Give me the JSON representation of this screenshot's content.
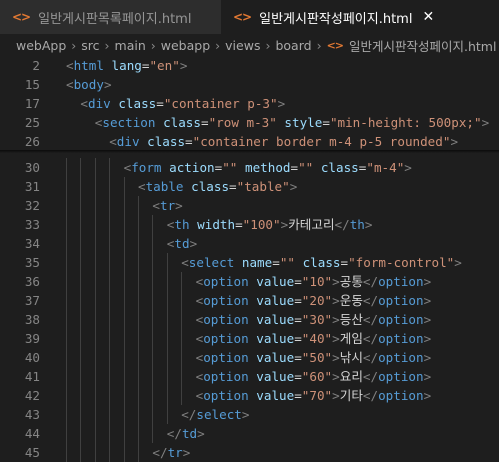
{
  "tabs": [
    {
      "icon": "<>",
      "label": "일반게시판목록페이지.html",
      "active": false
    },
    {
      "icon": "<>",
      "label": "일반게시판작성페이지.html",
      "active": true,
      "close": "✕"
    }
  ],
  "breadcrumb": {
    "items": [
      "webApp",
      "src",
      "main",
      "webapp",
      "views",
      "board"
    ],
    "file_icon": "<>",
    "file": "일반게시판작성페이지.html"
  },
  "colors": {
    "tag": "#569cd6",
    "attr": "#9cdcfe",
    "string": "#ce9178",
    "text": "#d4d4d4",
    "line_number": "#858585",
    "file_icon": "#e37933"
  },
  "lines": [
    {
      "n": "2",
      "indent": 0,
      "tokens": [
        [
          "br",
          "<"
        ],
        [
          "tg",
          "html"
        ],
        [
          "tx",
          " "
        ],
        [
          "at",
          "lang"
        ],
        [
          "tx",
          "="
        ],
        [
          "st",
          "\"en\""
        ],
        [
          "br",
          ">"
        ]
      ]
    },
    {
      "n": "15",
      "indent": 0,
      "tokens": [
        [
          "br",
          "<"
        ],
        [
          "tg",
          "body"
        ],
        [
          "br",
          ">"
        ]
      ]
    },
    {
      "n": "17",
      "indent": 1,
      "tokens": [
        [
          "br",
          "<"
        ],
        [
          "tg",
          "div"
        ],
        [
          "tx",
          " "
        ],
        [
          "at",
          "class"
        ],
        [
          "tx",
          "="
        ],
        [
          "st",
          "\"container p-3\""
        ],
        [
          "br",
          ">"
        ]
      ]
    },
    {
      "n": "25",
      "indent": 2,
      "tokens": [
        [
          "br",
          "<"
        ],
        [
          "tg",
          "section"
        ],
        [
          "tx",
          " "
        ],
        [
          "at",
          "class"
        ],
        [
          "tx",
          "="
        ],
        [
          "st",
          "\"row m-3\""
        ],
        [
          "tx",
          " "
        ],
        [
          "at",
          "style"
        ],
        [
          "tx",
          "="
        ],
        [
          "st",
          "\"min-height: 500px;\""
        ],
        [
          "br",
          ">"
        ]
      ]
    },
    {
      "n": "26",
      "indent": 3,
      "tokens": [
        [
          "br",
          "<"
        ],
        [
          "tg",
          "div"
        ],
        [
          "tx",
          " "
        ],
        [
          "at",
          "class"
        ],
        [
          "tx",
          "="
        ],
        [
          "st",
          "\"container border m-4 p-5 rounded\""
        ],
        [
          "br",
          ">"
        ]
      ]
    },
    {
      "n": "30",
      "indent": 4,
      "tokens": [
        [
          "br",
          "<"
        ],
        [
          "tg",
          "form"
        ],
        [
          "tx",
          " "
        ],
        [
          "at",
          "action"
        ],
        [
          "tx",
          "="
        ],
        [
          "st",
          "\"\""
        ],
        [
          "tx",
          " "
        ],
        [
          "at",
          "method"
        ],
        [
          "tx",
          "="
        ],
        [
          "st",
          "\"\""
        ],
        [
          "tx",
          " "
        ],
        [
          "at",
          "class"
        ],
        [
          "tx",
          "="
        ],
        [
          "st",
          "\"m-4\""
        ],
        [
          "br",
          ">"
        ]
      ]
    },
    {
      "n": "31",
      "indent": 5,
      "tokens": [
        [
          "br",
          "<"
        ],
        [
          "tg",
          "table"
        ],
        [
          "tx",
          " "
        ],
        [
          "at",
          "class"
        ],
        [
          "tx",
          "="
        ],
        [
          "st",
          "\"table\""
        ],
        [
          "br",
          ">"
        ]
      ]
    },
    {
      "n": "32",
      "indent": 6,
      "tokens": [
        [
          "br",
          "<"
        ],
        [
          "tg",
          "tr"
        ],
        [
          "br",
          ">"
        ]
      ]
    },
    {
      "n": "33",
      "indent": 7,
      "tokens": [
        [
          "br",
          "<"
        ],
        [
          "tg",
          "th"
        ],
        [
          "tx",
          " "
        ],
        [
          "at",
          "width"
        ],
        [
          "tx",
          "="
        ],
        [
          "st",
          "\"100\""
        ],
        [
          "br",
          ">"
        ],
        [
          "tx",
          "카테고리"
        ],
        [
          "br",
          "</"
        ],
        [
          "tg",
          "th"
        ],
        [
          "br",
          ">"
        ]
      ]
    },
    {
      "n": "34",
      "indent": 7,
      "tokens": [
        [
          "br",
          "<"
        ],
        [
          "tg",
          "td"
        ],
        [
          "br",
          ">"
        ]
      ]
    },
    {
      "n": "35",
      "indent": 8,
      "tokens": [
        [
          "br",
          "<"
        ],
        [
          "tg",
          "select"
        ],
        [
          "tx",
          " "
        ],
        [
          "at",
          "name"
        ],
        [
          "tx",
          "="
        ],
        [
          "st",
          "\"\""
        ],
        [
          "tx",
          " "
        ],
        [
          "at",
          "class"
        ],
        [
          "tx",
          "="
        ],
        [
          "st",
          "\"form-control\""
        ],
        [
          "br",
          ">"
        ]
      ]
    },
    {
      "n": "36",
      "indent": 9,
      "tokens": [
        [
          "br",
          "<"
        ],
        [
          "tg",
          "option"
        ],
        [
          "tx",
          " "
        ],
        [
          "at",
          "value"
        ],
        [
          "tx",
          "="
        ],
        [
          "st",
          "\"10\""
        ],
        [
          "br",
          ">"
        ],
        [
          "tx",
          "공통"
        ],
        [
          "br",
          "</"
        ],
        [
          "tg",
          "option"
        ],
        [
          "br",
          ">"
        ]
      ]
    },
    {
      "n": "37",
      "indent": 9,
      "tokens": [
        [
          "br",
          "<"
        ],
        [
          "tg",
          "option"
        ],
        [
          "tx",
          " "
        ],
        [
          "at",
          "value"
        ],
        [
          "tx",
          "="
        ],
        [
          "st",
          "\"20\""
        ],
        [
          "br",
          ">"
        ],
        [
          "tx",
          "운동"
        ],
        [
          "br",
          "</"
        ],
        [
          "tg",
          "option"
        ],
        [
          "br",
          ">"
        ]
      ]
    },
    {
      "n": "38",
      "indent": 9,
      "tokens": [
        [
          "br",
          "<"
        ],
        [
          "tg",
          "option"
        ],
        [
          "tx",
          " "
        ],
        [
          "at",
          "value"
        ],
        [
          "tx",
          "="
        ],
        [
          "st",
          "\"30\""
        ],
        [
          "br",
          ">"
        ],
        [
          "tx",
          "등산"
        ],
        [
          "br",
          "</"
        ],
        [
          "tg",
          "option"
        ],
        [
          "br",
          ">"
        ]
      ]
    },
    {
      "n": "39",
      "indent": 9,
      "tokens": [
        [
          "br",
          "<"
        ],
        [
          "tg",
          "option"
        ],
        [
          "tx",
          " "
        ],
        [
          "at",
          "value"
        ],
        [
          "tx",
          "="
        ],
        [
          "st",
          "\"40\""
        ],
        [
          "br",
          ">"
        ],
        [
          "tx",
          "게임"
        ],
        [
          "br",
          "</"
        ],
        [
          "tg",
          "option"
        ],
        [
          "br",
          ">"
        ]
      ]
    },
    {
      "n": "40",
      "indent": 9,
      "tokens": [
        [
          "br",
          "<"
        ],
        [
          "tg",
          "option"
        ],
        [
          "tx",
          " "
        ],
        [
          "at",
          "value"
        ],
        [
          "tx",
          "="
        ],
        [
          "st",
          "\"50\""
        ],
        [
          "br",
          ">"
        ],
        [
          "tx",
          "낚시"
        ],
        [
          "br",
          "</"
        ],
        [
          "tg",
          "option"
        ],
        [
          "br",
          ">"
        ]
      ]
    },
    {
      "n": "41",
      "indent": 9,
      "tokens": [
        [
          "br",
          "<"
        ],
        [
          "tg",
          "option"
        ],
        [
          "tx",
          " "
        ],
        [
          "at",
          "value"
        ],
        [
          "tx",
          "="
        ],
        [
          "st",
          "\"60\""
        ],
        [
          "br",
          ">"
        ],
        [
          "tx",
          "요리"
        ],
        [
          "br",
          "</"
        ],
        [
          "tg",
          "option"
        ],
        [
          "br",
          ">"
        ]
      ]
    },
    {
      "n": "42",
      "indent": 9,
      "tokens": [
        [
          "br",
          "<"
        ],
        [
          "tg",
          "option"
        ],
        [
          "tx",
          " "
        ],
        [
          "at",
          "value"
        ],
        [
          "tx",
          "="
        ],
        [
          "st",
          "\"70\""
        ],
        [
          "br",
          ">"
        ],
        [
          "tx",
          "기타"
        ],
        [
          "br",
          "</"
        ],
        [
          "tg",
          "option"
        ],
        [
          "br",
          ">"
        ]
      ]
    },
    {
      "n": "43",
      "indent": 8,
      "tokens": [
        [
          "br",
          "</"
        ],
        [
          "tg",
          "select"
        ],
        [
          "br",
          ">"
        ]
      ]
    },
    {
      "n": "44",
      "indent": 7,
      "tokens": [
        [
          "br",
          "</"
        ],
        [
          "tg",
          "td"
        ],
        [
          "br",
          ">"
        ]
      ]
    },
    {
      "n": "45",
      "indent": 6,
      "tokens": [
        [
          "br",
          "</"
        ],
        [
          "tg",
          "tr"
        ],
        [
          "br",
          ">"
        ]
      ]
    }
  ]
}
